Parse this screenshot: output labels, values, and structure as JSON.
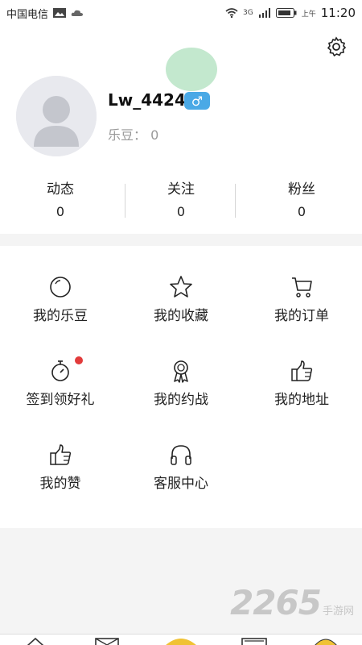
{
  "status_bar": {
    "carrier": "中国电信",
    "network": "3G",
    "period": "上午",
    "time": "11:20"
  },
  "profile": {
    "username": "Lw_4424",
    "gender": "♂",
    "ledou_label": "乐豆：",
    "ledou_value": "0"
  },
  "stats": [
    {
      "label": "动态",
      "value": "0"
    },
    {
      "label": "关注",
      "value": "0"
    },
    {
      "label": "粉丝",
      "value": "0"
    }
  ],
  "menu": [
    {
      "label": "我的乐豆",
      "icon": "circle-icon"
    },
    {
      "label": "我的收藏",
      "icon": "star-icon"
    },
    {
      "label": "我的订单",
      "icon": "cart-icon"
    },
    {
      "label": "签到领好礼",
      "icon": "stopwatch-icon"
    },
    {
      "label": "我的约战",
      "icon": "award-icon"
    },
    {
      "label": "我的地址",
      "icon": "thumbs-up-icon"
    },
    {
      "label": "我的赞",
      "icon": "thumbs-up-icon"
    },
    {
      "label": "客服中心",
      "icon": "headphones-icon"
    }
  ],
  "watermark": {
    "number": "2265",
    "text": "手游网"
  },
  "colors": {
    "badge": "#4aa9e6",
    "notification_dot": "#e23b3b",
    "accent_green": "#b9e4c5"
  }
}
